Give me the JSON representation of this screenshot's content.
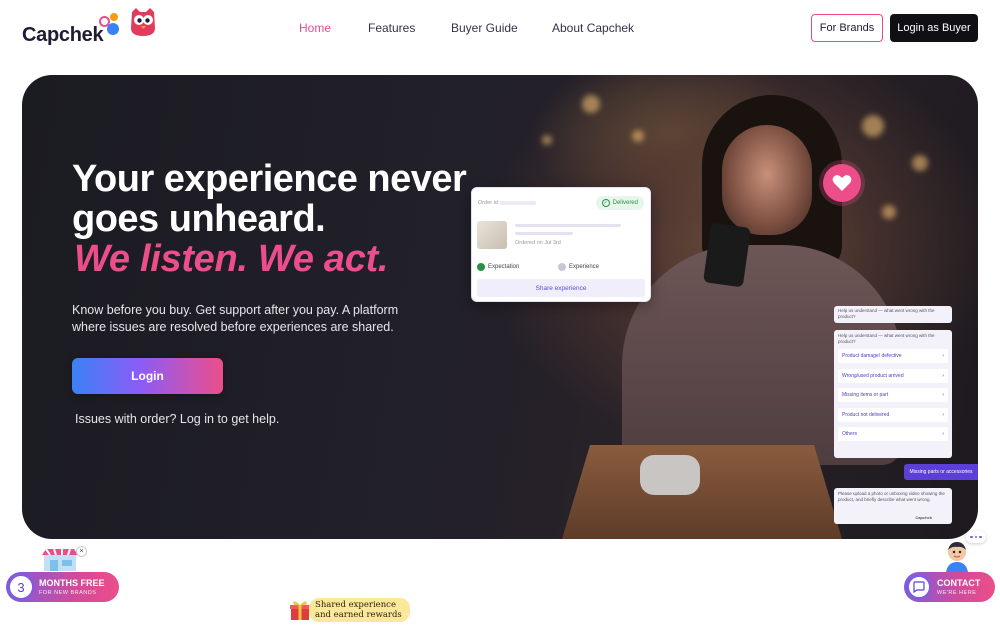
{
  "header": {
    "logo_text": "Capchek",
    "nav": [
      {
        "label": "Home",
        "active": true
      },
      {
        "label": "Features",
        "active": false
      },
      {
        "label": "Buyer Guide",
        "active": false
      },
      {
        "label": "About Capchek",
        "active": false
      }
    ],
    "for_brands_label": "For Brands",
    "login_buyer_label": "Login as Buyer"
  },
  "hero": {
    "title_line1": "Your experience never",
    "title_line2": "goes unheard.",
    "accent": "We listen. We act.",
    "subtitle": "Know before you buy. Get support after you pay. A platform where issues are resolved before experiences are shared.",
    "login_label": "Login",
    "issues_text": "Issues with order? Log in to get help."
  },
  "order_card": {
    "order_id_label": "Order id:",
    "status": "Delivered",
    "ordered_on": "Ordered on Jul 3rd",
    "expectation": "Expectation",
    "experience": "Experience",
    "share_label": "Share experience"
  },
  "chat": {
    "question_short": "Help us understand — what went wrong with the product?",
    "question": "Help us understand — what went wrong with the product?",
    "options": [
      "Product damage/ defective",
      "Wrong/used product arrived",
      "Missing items or part",
      "Product not delivered",
      "Others"
    ],
    "selected_reply": "Missing parts or accessories",
    "upload_prompt": "Please upload a photo or unboxing video showing the product, and briefly describe what went wrong.",
    "signature": "Capchek"
  },
  "promo": {
    "number": "3",
    "main": "MONTHS FREE",
    "sub": "FOR NEW BRANDS",
    "close": "×"
  },
  "reward": {
    "line1": "Shared experience",
    "line2": "and earned rewards"
  },
  "contact": {
    "main": "CONTACT",
    "sub": "WE'RE HERE"
  },
  "colors": {
    "brand_pink": "#ec4e8a",
    "brand_blue": "#3b82f6",
    "brand_purple": "#7c5ce0",
    "dark": "#0f0f14"
  }
}
